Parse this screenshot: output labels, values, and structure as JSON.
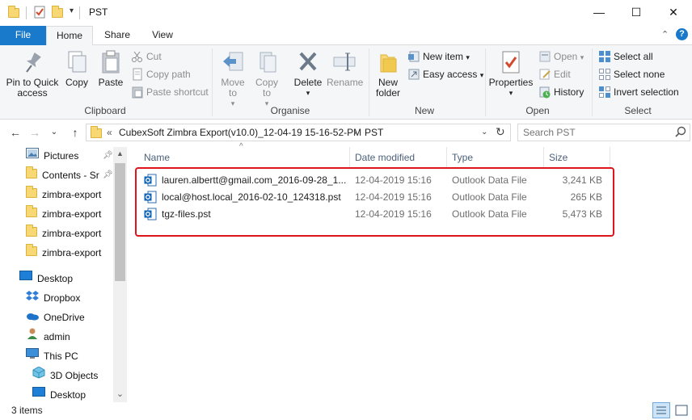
{
  "window": {
    "title": "PST",
    "minimize": "—",
    "maximize": "☐",
    "close": "✕"
  },
  "ribbon_tabs": [
    "File",
    "Home",
    "Share",
    "View"
  ],
  "ribbon": {
    "clipboard": {
      "label": "Clipboard",
      "pin": "Pin to Quick access",
      "copy": "Copy",
      "paste": "Paste",
      "cut": "Cut",
      "copy_path": "Copy path",
      "paste_shortcut": "Paste shortcut"
    },
    "organise": {
      "label": "Organise",
      "move_to": "Move to",
      "copy_to": "Copy to",
      "delete": "Delete",
      "rename": "Rename"
    },
    "new": {
      "label": "New",
      "new_folder": "New folder",
      "new_item": "New item",
      "easy_access": "Easy access"
    },
    "open": {
      "label": "Open",
      "properties": "Properties",
      "open": "Open",
      "edit": "Edit",
      "history": "History"
    },
    "select": {
      "label": "Select",
      "select_all": "Select all",
      "select_none": "Select none",
      "invert_selection": "Invert selection"
    }
  },
  "address": {
    "overflow": "«",
    "segments": [
      "CubexSoft Zimbra Export(v10.0)_12-04-19 15-16-52-PM",
      "PST"
    ],
    "separator": "›",
    "search_placeholder": "Search PST"
  },
  "nav_pane": {
    "items": [
      {
        "label": "Pictures",
        "icon": "pictures-icon",
        "pinned": true
      },
      {
        "label": "Contents - Sr",
        "icon": "folder-icon",
        "pinned": true
      },
      {
        "label": "zimbra-export",
        "icon": "folder-icon"
      },
      {
        "label": "zimbra-export",
        "icon": "folder-icon"
      },
      {
        "label": "zimbra-export",
        "icon": "folder-icon"
      },
      {
        "label": "zimbra-export",
        "icon": "folder-icon"
      },
      {
        "label": "Desktop",
        "icon": "desktop-icon"
      },
      {
        "label": "Dropbox",
        "icon": "dropbox-icon"
      },
      {
        "label": "OneDrive",
        "icon": "onedrive-icon"
      },
      {
        "label": "admin",
        "icon": "user-icon"
      },
      {
        "label": "This PC",
        "icon": "pc-icon"
      },
      {
        "label": "3D Objects",
        "icon": "3d-objects-icon"
      },
      {
        "label": "Desktop",
        "icon": "desktop-icon"
      }
    ]
  },
  "file_list": {
    "columns": [
      "Name",
      "Date modified",
      "Type",
      "Size"
    ],
    "rows": [
      {
        "name": "lauren.albertt@gmail.com_2016-09-28_1...",
        "date": "12-04-2019 15:16",
        "type": "Outlook Data File",
        "size": "3,241 KB"
      },
      {
        "name": "local@host.local_2016-02-10_124318.pst",
        "date": "12-04-2019 15:16",
        "type": "Outlook Data File",
        "size": "265 KB"
      },
      {
        "name": "tgz-files.pst",
        "date": "12-04-2019 15:16",
        "type": "Outlook Data File",
        "size": "5,473 KB"
      }
    ]
  },
  "status_bar": {
    "count": "3 items"
  },
  "colors": {
    "file_tab": "#1979ca",
    "highlight_border": "#e0151b",
    "folder": "#f8d775"
  }
}
